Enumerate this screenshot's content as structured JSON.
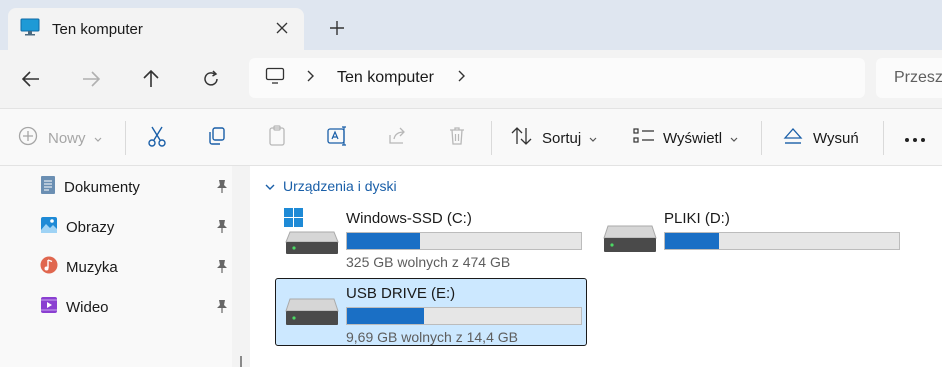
{
  "tab": {
    "title": "Ten komputer"
  },
  "address": {
    "crumb": "Ten komputer",
    "search_placeholder": "Przesz"
  },
  "commands": {
    "new_label": "Nowy",
    "sort_label": "Sortuj",
    "view_label": "Wyświetl",
    "eject_label": "Wysuń"
  },
  "sidebar": {
    "items": [
      {
        "label": "Dokumenty",
        "icon": "documents-icon"
      },
      {
        "label": "Obrazy",
        "icon": "pictures-icon"
      },
      {
        "label": "Muzyka",
        "icon": "music-icon"
      },
      {
        "label": "Wideo",
        "icon": "video-icon"
      }
    ]
  },
  "main": {
    "group_title": "Urządzenia i dyski",
    "drives": [
      {
        "name": "Windows-SSD (C:)",
        "free": "325 GB wolnych z 474 GB",
        "used_fraction": 0.31
      },
      {
        "name": "PLIKI (D:)",
        "free": "",
        "used_fraction": 0.23
      },
      {
        "name": "USB DRIVE (E:)",
        "free": "9,69 GB wolnych z 14,4 GB",
        "used_fraction": 0.33
      }
    ]
  },
  "colors": {
    "accent": "#1a6fc5",
    "selection": "#cce8ff",
    "tabstrip": "#dfe6f0"
  }
}
